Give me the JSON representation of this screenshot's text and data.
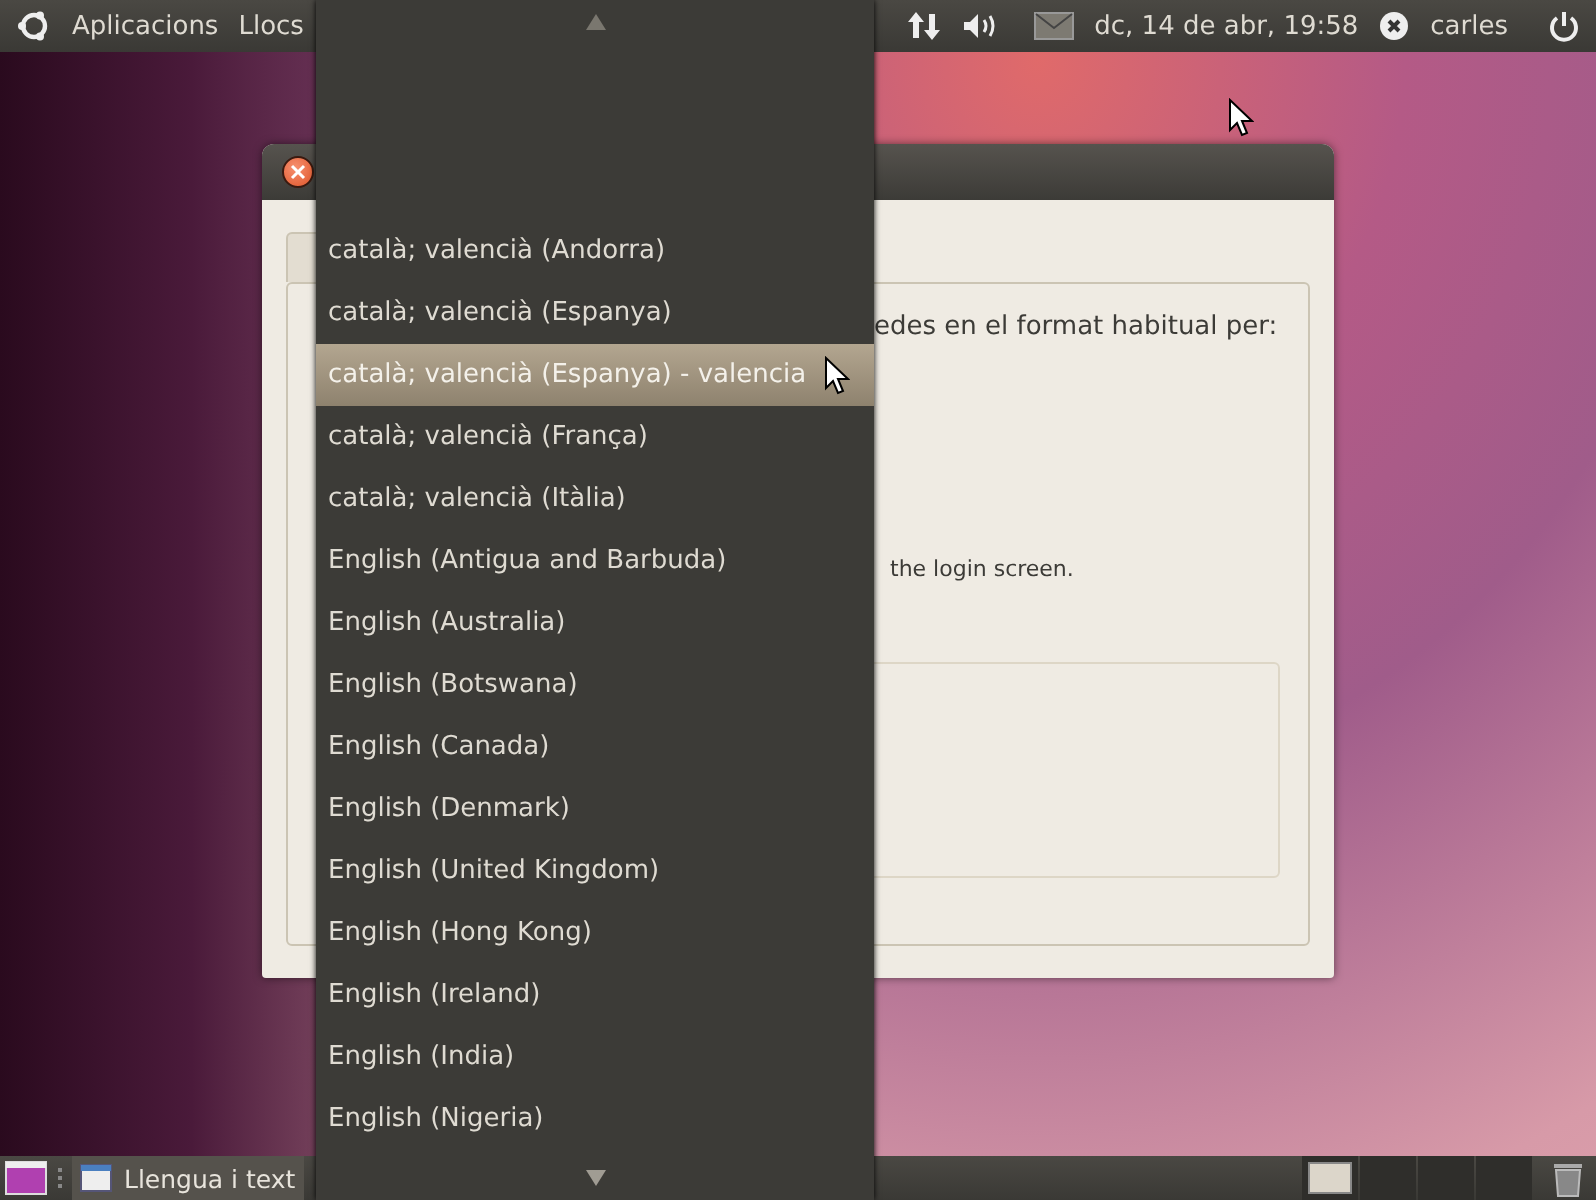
{
  "top_panel": {
    "menus": [
      "Aplicacions",
      "Llocs"
    ],
    "clock": "dc, 14 de abr, 19:58",
    "user": "carles"
  },
  "dialog": {
    "texts": [
      "edes en el format habitual per:",
      "the login screen."
    ]
  },
  "dropdown": {
    "items": [
      {
        "label": "català; valencià (Andorra)",
        "selected": false
      },
      {
        "label": "català; valencià (Espanya)",
        "selected": false
      },
      {
        "label": "català; valencià (Espanya) - valencia",
        "selected": true
      },
      {
        "label": "català; valencià (França)",
        "selected": false
      },
      {
        "label": "català; valencià (Itàlia)",
        "selected": false
      },
      {
        "label": "English (Antigua and Barbuda)",
        "selected": false
      },
      {
        "label": "English (Australia)",
        "selected": false
      },
      {
        "label": "English (Botswana)",
        "selected": false
      },
      {
        "label": "English (Canada)",
        "selected": false
      },
      {
        "label": "English (Denmark)",
        "selected": false
      },
      {
        "label": "English (United Kingdom)",
        "selected": false
      },
      {
        "label": "English (Hong Kong)",
        "selected": false
      },
      {
        "label": "English (Ireland)",
        "selected": false
      },
      {
        "label": "English (India)",
        "selected": false
      },
      {
        "label": "English (Nigeria)",
        "selected": false
      }
    ]
  },
  "bottom_panel": {
    "window_button": "Llengua i text",
    "workspaces": [
      {
        "selected": true
      },
      {
        "selected": false
      },
      {
        "selected": false
      },
      {
        "selected": false
      }
    ]
  }
}
